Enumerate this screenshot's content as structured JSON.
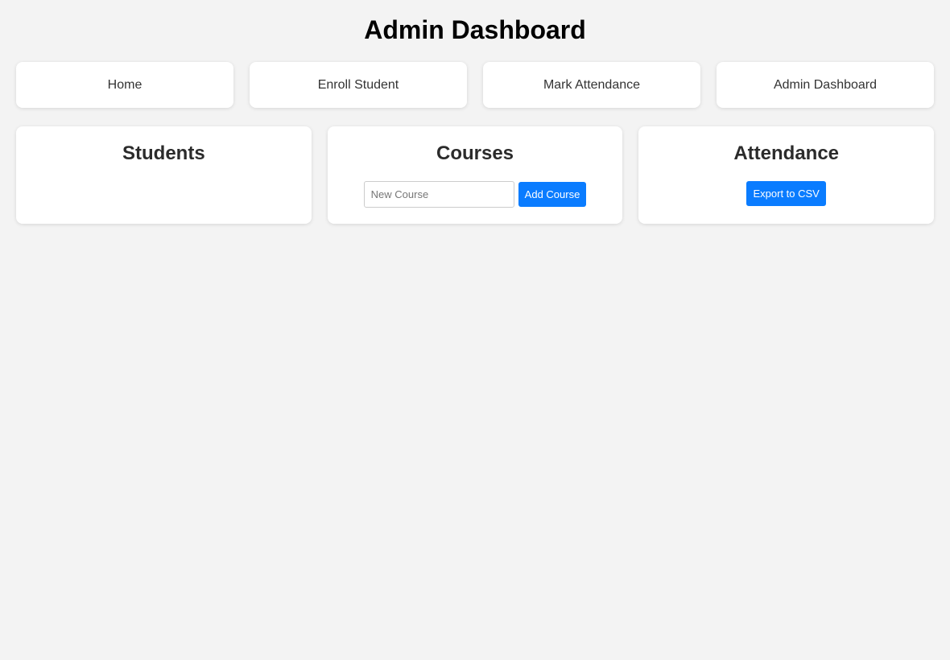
{
  "header": {
    "title": "Admin Dashboard"
  },
  "nav": {
    "items": [
      {
        "label": "Home"
      },
      {
        "label": "Enroll Student"
      },
      {
        "label": "Mark Attendance"
      },
      {
        "label": "Admin Dashboard"
      }
    ]
  },
  "panels": {
    "students": {
      "title": "Students"
    },
    "courses": {
      "title": "Courses",
      "new_course_placeholder": "New Course",
      "new_course_value": "",
      "add_button_label": "Add Course"
    },
    "attendance": {
      "title": "Attendance",
      "export_button_label": "Export to CSV"
    }
  },
  "colors": {
    "background": "#f3f3f3",
    "card": "#ffffff",
    "primary_button": "#0a7cff"
  }
}
